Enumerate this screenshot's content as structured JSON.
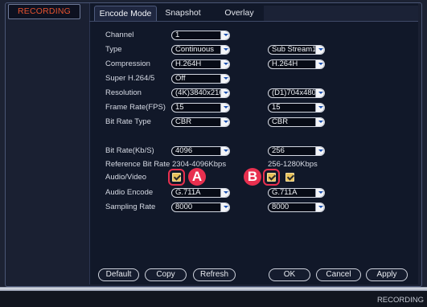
{
  "window": {
    "title": "RECORDING"
  },
  "tabs": [
    {
      "label": "Encode Mode",
      "active": true
    },
    {
      "label": "Snapshot",
      "active": false
    },
    {
      "label": "Overlay",
      "active": false
    }
  ],
  "fields": {
    "channel": {
      "label": "Channel",
      "main": "1"
    },
    "type": {
      "label": "Type",
      "main": "Continuous",
      "sub": "Sub Stream1"
    },
    "compression": {
      "label": "Compression",
      "main": "H.264H",
      "sub": "H.264H"
    },
    "super_h264": {
      "label": "Super H.264/5",
      "main": "Off"
    },
    "resolution": {
      "label": "Resolution",
      "main": "(4K)3840x216",
      "sub": "(D1)704x480"
    },
    "frame_rate": {
      "label": "Frame Rate(FPS)",
      "main": "15",
      "sub": "15"
    },
    "bit_rate_type": {
      "label": "Bit Rate Type",
      "main": "CBR",
      "sub": "CBR"
    },
    "bit_rate": {
      "label": "Bit Rate(Kb/S)",
      "main": "4096",
      "sub": "256"
    },
    "reference_bit_rate": {
      "label": "Reference Bit Rate",
      "main": "2304-4096Kbps",
      "sub": "256-1280Kbps"
    },
    "audio_video": {
      "label": "Audio/Video",
      "main_checked": true,
      "sub_video_checked": true,
      "sub_audio_checked": true
    },
    "audio_encode": {
      "label": "Audio Encode",
      "main": "G.711A",
      "sub": "G.711A"
    },
    "sampling_rate": {
      "label": "Sampling Rate",
      "main": "8000",
      "sub": "8000"
    }
  },
  "callouts": {
    "a": "A",
    "b": "B"
  },
  "buttons": {
    "default": "Default",
    "copy": "Copy",
    "refresh": "Refresh",
    "ok": "OK",
    "cancel": "Cancel",
    "apply": "Apply"
  },
  "status_bar": {
    "text": "RECORDING"
  },
  "colors": {
    "title_accent": "#e7532f",
    "callout": "#e8304f",
    "checkbox": "#e8c25a",
    "background": "#1c2233"
  },
  "icons": [
    "chevron-down-icon",
    "checkmark-icon"
  ]
}
